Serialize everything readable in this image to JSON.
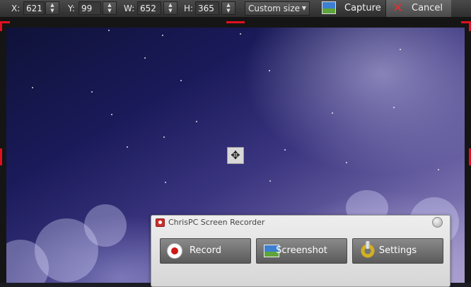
{
  "toolbar": {
    "x_label": "X:",
    "x_value": "621",
    "y_label": "Y:",
    "y_value": "99",
    "w_label": "W:",
    "w_value": "652",
    "h_label": "H:",
    "h_value": "365",
    "size_mode": "Custom size",
    "capture_label": "Capture",
    "cancel_label": "Cancel",
    "icons": {
      "spin_up": "▲",
      "spin_down": "▼",
      "dropdown_arrow": "▼",
      "capture": "landscape-icon",
      "cancel": "✕"
    }
  },
  "capture_area": {
    "move_handle_icon": "✥",
    "marker_color": "#e01020"
  },
  "recorder": {
    "title": "ChrisPC Screen Recorder",
    "buttons": {
      "record": "Record",
      "screenshot": "Screenshot",
      "settings": "Settings"
    }
  }
}
